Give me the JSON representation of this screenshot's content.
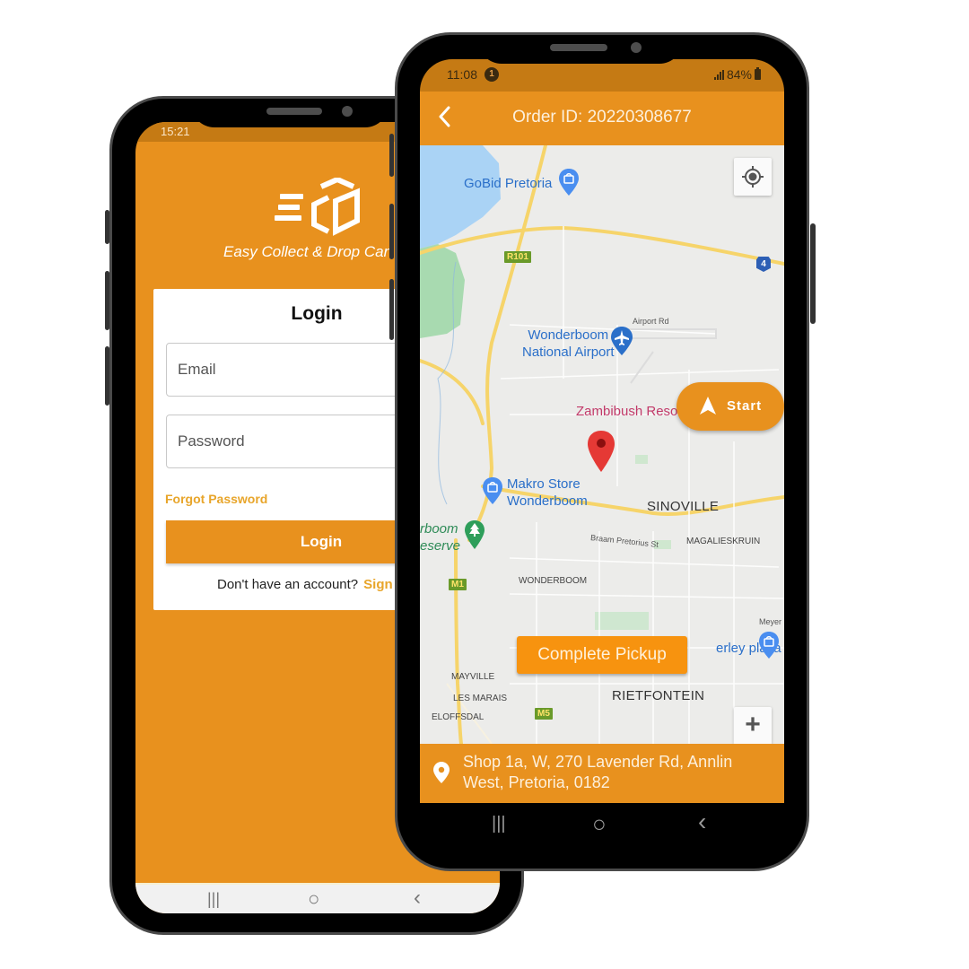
{
  "brand": {
    "primary_color": "#E8911E",
    "status_bar_color": "#C57A14",
    "link_color": "#E8A52A"
  },
  "login_phone": {
    "status_bar": {
      "time": "15:21"
    },
    "logo": {
      "icon": "eco-box-logo-icon",
      "tagline": "Easy Collect & Drop Car"
    },
    "card": {
      "title": "Login",
      "email_placeholder": "Email",
      "password_placeholder": "Password",
      "forgot_password": "Forgot Password",
      "login_button": "Login",
      "signup_prompt": "Don't have an account?",
      "signup_link": "Sign"
    },
    "nav_bar": {
      "recents": "|||",
      "home": "○",
      "back": "‹"
    }
  },
  "order_phone": {
    "status_bar": {
      "time": "11:08",
      "notification_count": "1",
      "battery": "84%"
    },
    "header": {
      "title": "Order ID: 20220308677",
      "back_icon": "chevron-left-icon"
    },
    "map": {
      "pois": [
        {
          "name": "GoBid Pretoria",
          "type": "shopping"
        },
        {
          "name": "Wonderboom National Airport",
          "line1": "Wonderboom",
          "line2": "National Airport",
          "type": "airport"
        },
        {
          "name": "Zambibush Reso",
          "type": "poi-pink"
        },
        {
          "name": "Makro Store Wonderboom",
          "line1": "Makro Store",
          "line2": "Wonderboom",
          "type": "shopping"
        },
        {
          "name": "rboom Reserve",
          "line1": "rboom",
          "line2": "eserve",
          "type": "park"
        },
        {
          "name": "erley plaza",
          "type": "shopping"
        }
      ],
      "areas": [
        "SINOVILLE",
        "MAGALIESKRUIN",
        "WONDERBOOM",
        "RIETFONTEIN",
        "MAYVILLE",
        "LES MARAIS",
        "ELOFFSDAL"
      ],
      "streets": [
        "Airport Rd",
        "Braam Pretorius St",
        "Meyer St"
      ],
      "route_shields": [
        "R101",
        "M1",
        "M5"
      ],
      "highway_shields": [
        "4"
      ],
      "start_button": "Start",
      "complete_pickup_button": "Complete Pickup",
      "zoom_in": "+"
    },
    "address": "Shop 1a, W, 270 Lavender Rd, Annlin West, Pretoria, 0182",
    "nav_bar": {
      "recents": "|||",
      "home": "○",
      "back": "‹"
    }
  }
}
